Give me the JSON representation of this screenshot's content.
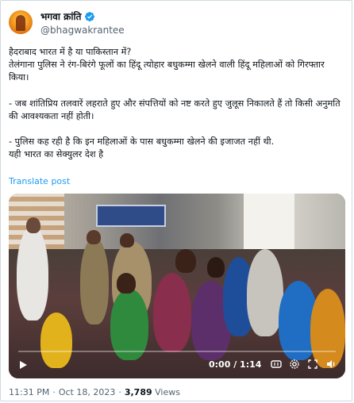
{
  "author": {
    "name": "भगवा क्रांति",
    "handle": "@bhagwakrantee"
  },
  "tweet": {
    "lines": [
      "हैदराबाद भारत में है या पाकिस्तान में?",
      "तेलंगाना पुलिस ने रंग-बिरंगे फूलों का हिंदू त्योहार बधुकम्मा खेलने वाली हिंदू महिलाओं को गिरफ्तार किया।",
      "- जब शांतिप्रिय तलवारें लहराते हुए और संपत्तियों को नष्ट करते हुए जुलूस निकालते हैं तो किसी अनुमति की आवश्यकता नहीं होती।",
      "- पुलिस कह रही है कि इन महिलाओं के पास बधुकम्मा खेलने की इजाजत नहीं थी.",
      "यही भारत का सेक्युलर देश है"
    ],
    "translate_label": "Translate post"
  },
  "video": {
    "time": "0:00 / 1:14",
    "progress": 0
  },
  "meta": {
    "time": "11:31 PM",
    "date": "Oct 18, 2023",
    "views_count": "3,789",
    "views_label": "Views"
  },
  "colors": {
    "link": "#1d9bf0",
    "verified": "#1d9bf0",
    "muted": "#536471"
  }
}
